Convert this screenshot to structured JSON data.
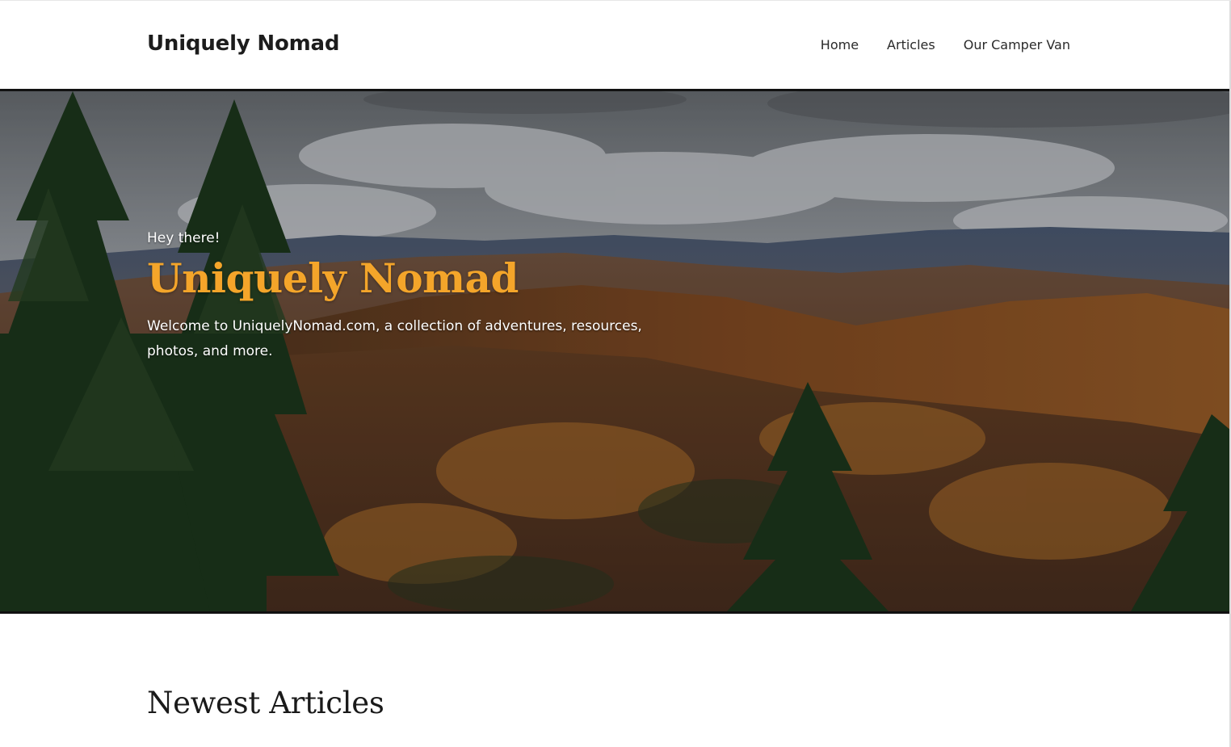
{
  "header": {
    "site_title": "Uniquely Nomad",
    "nav": [
      {
        "label": "Home"
      },
      {
        "label": "Articles"
      },
      {
        "label": "Our Camper Van"
      }
    ]
  },
  "hero": {
    "eyebrow": "Hey there!",
    "title": "Uniquely Nomad",
    "text": "Welcome to UniquelyNomad.com, a collection of adventures, resources, photos, and more.",
    "title_color": "#f4a52a"
  },
  "main": {
    "section_title": "Newest Articles"
  }
}
